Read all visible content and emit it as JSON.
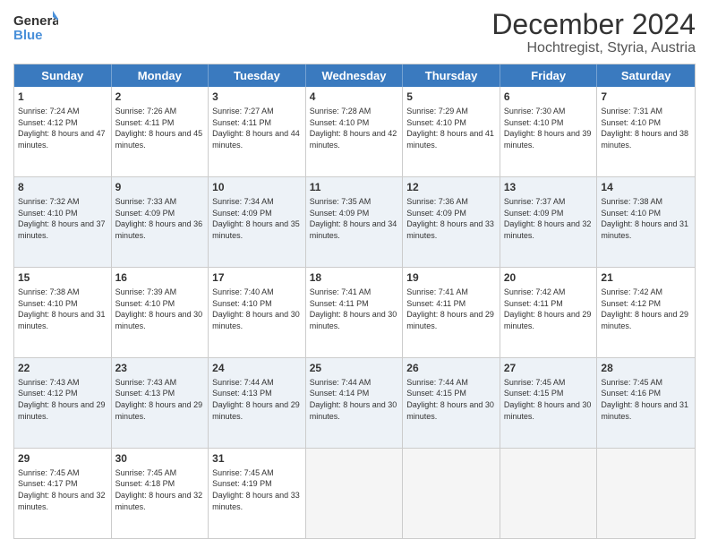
{
  "logo": {
    "line1": "General",
    "line2": "Blue"
  },
  "title": "December 2024",
  "subtitle": "Hochtregist, Styria, Austria",
  "weekdays": [
    "Sunday",
    "Monday",
    "Tuesday",
    "Wednesday",
    "Thursday",
    "Friday",
    "Saturday"
  ],
  "weeks": [
    [
      {
        "day": "1",
        "sunrise": "Sunrise: 7:24 AM",
        "sunset": "Sunset: 4:12 PM",
        "daylight": "Daylight: 8 hours and 47 minutes."
      },
      {
        "day": "2",
        "sunrise": "Sunrise: 7:26 AM",
        "sunset": "Sunset: 4:11 PM",
        "daylight": "Daylight: 8 hours and 45 minutes."
      },
      {
        "day": "3",
        "sunrise": "Sunrise: 7:27 AM",
        "sunset": "Sunset: 4:11 PM",
        "daylight": "Daylight: 8 hours and 44 minutes."
      },
      {
        "day": "4",
        "sunrise": "Sunrise: 7:28 AM",
        "sunset": "Sunset: 4:10 PM",
        "daylight": "Daylight: 8 hours and 42 minutes."
      },
      {
        "day": "5",
        "sunrise": "Sunrise: 7:29 AM",
        "sunset": "Sunset: 4:10 PM",
        "daylight": "Daylight: 8 hours and 41 minutes."
      },
      {
        "day": "6",
        "sunrise": "Sunrise: 7:30 AM",
        "sunset": "Sunset: 4:10 PM",
        "daylight": "Daylight: 8 hours and 39 minutes."
      },
      {
        "day": "7",
        "sunrise": "Sunrise: 7:31 AM",
        "sunset": "Sunset: 4:10 PM",
        "daylight": "Daylight: 8 hours and 38 minutes."
      }
    ],
    [
      {
        "day": "8",
        "sunrise": "Sunrise: 7:32 AM",
        "sunset": "Sunset: 4:10 PM",
        "daylight": "Daylight: 8 hours and 37 minutes."
      },
      {
        "day": "9",
        "sunrise": "Sunrise: 7:33 AM",
        "sunset": "Sunset: 4:09 PM",
        "daylight": "Daylight: 8 hours and 36 minutes."
      },
      {
        "day": "10",
        "sunrise": "Sunrise: 7:34 AM",
        "sunset": "Sunset: 4:09 PM",
        "daylight": "Daylight: 8 hours and 35 minutes."
      },
      {
        "day": "11",
        "sunrise": "Sunrise: 7:35 AM",
        "sunset": "Sunset: 4:09 PM",
        "daylight": "Daylight: 8 hours and 34 minutes."
      },
      {
        "day": "12",
        "sunrise": "Sunrise: 7:36 AM",
        "sunset": "Sunset: 4:09 PM",
        "daylight": "Daylight: 8 hours and 33 minutes."
      },
      {
        "day": "13",
        "sunrise": "Sunrise: 7:37 AM",
        "sunset": "Sunset: 4:09 PM",
        "daylight": "Daylight: 8 hours and 32 minutes."
      },
      {
        "day": "14",
        "sunrise": "Sunrise: 7:38 AM",
        "sunset": "Sunset: 4:10 PM",
        "daylight": "Daylight: 8 hours and 31 minutes."
      }
    ],
    [
      {
        "day": "15",
        "sunrise": "Sunrise: 7:38 AM",
        "sunset": "Sunset: 4:10 PM",
        "daylight": "Daylight: 8 hours and 31 minutes."
      },
      {
        "day": "16",
        "sunrise": "Sunrise: 7:39 AM",
        "sunset": "Sunset: 4:10 PM",
        "daylight": "Daylight: 8 hours and 30 minutes."
      },
      {
        "day": "17",
        "sunrise": "Sunrise: 7:40 AM",
        "sunset": "Sunset: 4:10 PM",
        "daylight": "Daylight: 8 hours and 30 minutes."
      },
      {
        "day": "18",
        "sunrise": "Sunrise: 7:41 AM",
        "sunset": "Sunset: 4:11 PM",
        "daylight": "Daylight: 8 hours and 30 minutes."
      },
      {
        "day": "19",
        "sunrise": "Sunrise: 7:41 AM",
        "sunset": "Sunset: 4:11 PM",
        "daylight": "Daylight: 8 hours and 29 minutes."
      },
      {
        "day": "20",
        "sunrise": "Sunrise: 7:42 AM",
        "sunset": "Sunset: 4:11 PM",
        "daylight": "Daylight: 8 hours and 29 minutes."
      },
      {
        "day": "21",
        "sunrise": "Sunrise: 7:42 AM",
        "sunset": "Sunset: 4:12 PM",
        "daylight": "Daylight: 8 hours and 29 minutes."
      }
    ],
    [
      {
        "day": "22",
        "sunrise": "Sunrise: 7:43 AM",
        "sunset": "Sunset: 4:12 PM",
        "daylight": "Daylight: 8 hours and 29 minutes."
      },
      {
        "day": "23",
        "sunrise": "Sunrise: 7:43 AM",
        "sunset": "Sunset: 4:13 PM",
        "daylight": "Daylight: 8 hours and 29 minutes."
      },
      {
        "day": "24",
        "sunrise": "Sunrise: 7:44 AM",
        "sunset": "Sunset: 4:13 PM",
        "daylight": "Daylight: 8 hours and 29 minutes."
      },
      {
        "day": "25",
        "sunrise": "Sunrise: 7:44 AM",
        "sunset": "Sunset: 4:14 PM",
        "daylight": "Daylight: 8 hours and 30 minutes."
      },
      {
        "day": "26",
        "sunrise": "Sunrise: 7:44 AM",
        "sunset": "Sunset: 4:15 PM",
        "daylight": "Daylight: 8 hours and 30 minutes."
      },
      {
        "day": "27",
        "sunrise": "Sunrise: 7:45 AM",
        "sunset": "Sunset: 4:15 PM",
        "daylight": "Daylight: 8 hours and 30 minutes."
      },
      {
        "day": "28",
        "sunrise": "Sunrise: 7:45 AM",
        "sunset": "Sunset: 4:16 PM",
        "daylight": "Daylight: 8 hours and 31 minutes."
      }
    ],
    [
      {
        "day": "29",
        "sunrise": "Sunrise: 7:45 AM",
        "sunset": "Sunset: 4:17 PM",
        "daylight": "Daylight: 8 hours and 32 minutes."
      },
      {
        "day": "30",
        "sunrise": "Sunrise: 7:45 AM",
        "sunset": "Sunset: 4:18 PM",
        "daylight": "Daylight: 8 hours and 32 minutes."
      },
      {
        "day": "31",
        "sunrise": "Sunrise: 7:45 AM",
        "sunset": "Sunset: 4:19 PM",
        "daylight": "Daylight: 8 hours and 33 minutes."
      },
      {
        "day": "",
        "sunrise": "",
        "sunset": "",
        "daylight": ""
      },
      {
        "day": "",
        "sunrise": "",
        "sunset": "",
        "daylight": ""
      },
      {
        "day": "",
        "sunrise": "",
        "sunset": "",
        "daylight": ""
      },
      {
        "day": "",
        "sunrise": "",
        "sunset": "",
        "daylight": ""
      }
    ]
  ]
}
